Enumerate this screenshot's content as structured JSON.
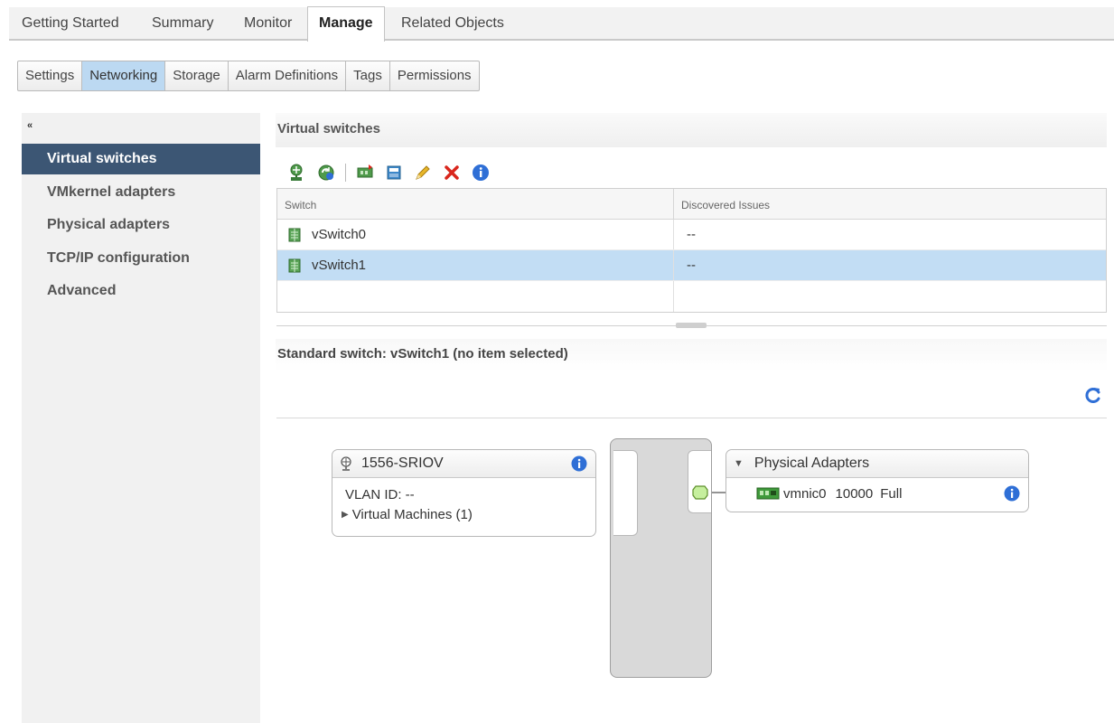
{
  "top_tabs": [
    {
      "label": "Getting Started"
    },
    {
      "label": "Summary"
    },
    {
      "label": "Monitor"
    },
    {
      "label": "Manage"
    },
    {
      "label": "Related Objects"
    }
  ],
  "active_top_tab": "Manage",
  "sub_tabs": [
    {
      "label": "Settings"
    },
    {
      "label": "Networking"
    },
    {
      "label": "Storage"
    },
    {
      "label": "Alarm Definitions"
    },
    {
      "label": "Tags"
    },
    {
      "label": "Permissions"
    }
  ],
  "active_sub_tab": "Networking",
  "sidebar": {
    "collapse_glyph": "«",
    "items": [
      {
        "label": "Virtual switches"
      },
      {
        "label": "VMkernel adapters"
      },
      {
        "label": "Physical adapters"
      },
      {
        "label": "TCP/IP configuration"
      },
      {
        "label": "Advanced"
      }
    ],
    "active": "Virtual switches"
  },
  "virtual_switches": {
    "title": "Virtual switches",
    "toolbar_icons": [
      "add-networking-icon",
      "refresh-networking-icon",
      "migrate-adapter-icon",
      "manage-adapters-icon",
      "edit-pencil-icon",
      "delete-x-icon",
      "info-icon"
    ],
    "columns": [
      "Switch",
      "Discovered Issues"
    ],
    "rows": [
      {
        "switch": "vSwitch0",
        "issues": "--"
      },
      {
        "switch": "vSwitch1",
        "issues": "--"
      }
    ],
    "selected_row": "vSwitch1"
  },
  "standard_switch": {
    "title": "Standard switch: vSwitch1 (no item selected)",
    "port_group": {
      "name": "1556-SRIOV",
      "vlan": "VLAN ID: --",
      "vms": "Virtual Machines (1)",
      "expand_glyph": "▶"
    },
    "physical_adapters": {
      "title": "Physical Adapters",
      "collapse_glyph": "▼",
      "adapters": [
        {
          "name": "vmnic0",
          "speed": "10000",
          "duplex": "Full"
        }
      ]
    }
  },
  "colors": {
    "active_nav": "#3c5674",
    "selected_row": "#c2ddf4",
    "active_subtab": "#bcd9f2",
    "info_blue": "#2f6fd6",
    "delete_red": "#d9261c"
  }
}
